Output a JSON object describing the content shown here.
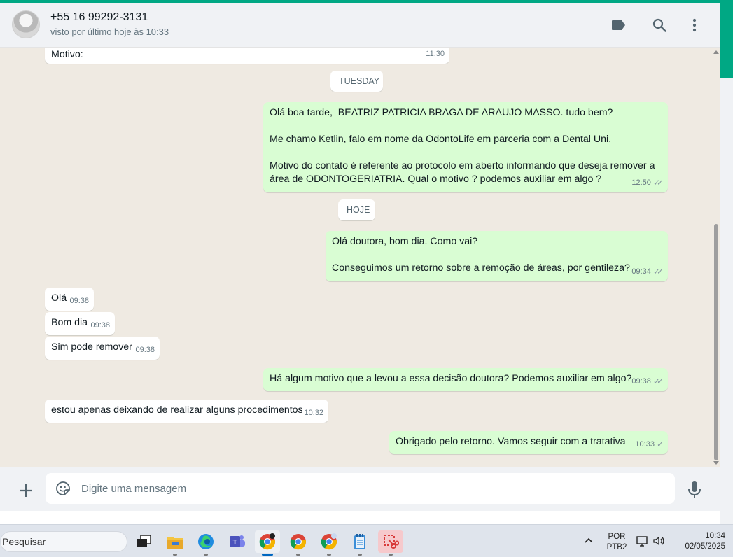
{
  "header": {
    "contact_name": "+55 16 99292-3131",
    "status": "visto por último hoje às 10:33",
    "icons": [
      "label-icon",
      "search-icon",
      "more-vert-icon"
    ]
  },
  "chat": {
    "partial_top": {
      "text": "Motivo:",
      "time": "11:30"
    },
    "day_tuesday": "TUESDAY",
    "day_today": "HOJE",
    "messages": [
      {
        "id": "m1",
        "dir": "out",
        "text": "Olá boa tarde,  BEATRIZ PATRICIA BRAGA DE ARAUJO MASSO. tudo bem?\n\nMe chamo Ketlin, falo em nome da OdontoLife em parceria com a Dental Uni.\n\nMotivo do contato é referente ao protocolo em aberto informando que deseja remover a área de ODONTOGERIATRIA. Qual o motivo ? podemos auxiliar em algo ?",
        "time": "12:50",
        "status": "read"
      },
      {
        "id": "m2",
        "dir": "out",
        "text": "Olá doutora, bom dia. Como vai?\n\nConseguimos um retorno sobre a remoção de áreas, por gentileza?",
        "time": "09:34",
        "status": "read"
      },
      {
        "id": "m3",
        "dir": "in",
        "text": "Olá",
        "time": "09:38"
      },
      {
        "id": "m4",
        "dir": "in",
        "text": "Bom dia",
        "time": "09:38"
      },
      {
        "id": "m5",
        "dir": "in",
        "text": "Sim pode remover",
        "time": "09:38"
      },
      {
        "id": "m6",
        "dir": "out",
        "text": "Há algum motivo que a levou a essa decisão doutora? Podemos auxiliar em algo?",
        "time": "09:38",
        "status": "read"
      },
      {
        "id": "m7",
        "dir": "in",
        "text": "estou apenas deixando de realizar alguns procedimentos",
        "time": "10:32"
      },
      {
        "id": "m8",
        "dir": "out",
        "text": "Obrigado pelo retorno. Vamos seguir com a tratativa",
        "time": "10:33",
        "status": "sent"
      }
    ]
  },
  "composer": {
    "placeholder": "Digite uma mensagem"
  },
  "taskbar": {
    "search_placeholder": "Pesquisar",
    "language": "POR",
    "layout": "PTB2",
    "time": "10:34",
    "date": "02/05/2025"
  },
  "colors": {
    "accent": "#00a884",
    "outgoing_bubble": "#d9fdd3",
    "incoming_bubble": "#ffffff",
    "chat_bg": "#efeae2"
  }
}
